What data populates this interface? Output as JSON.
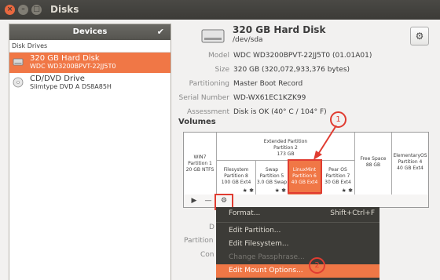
{
  "window": {
    "title": "Disks",
    "close_glyph": "×",
    "min_glyph": "–",
    "max_glyph": "□"
  },
  "sidebar": {
    "header": "Devices",
    "check_glyph": "✔",
    "section": "Disk Drives",
    "items": [
      {
        "line1": "320 GB Hard Disk",
        "line2": "WDC WD3200BPVT-22JJ5T0",
        "icon": "hard-disk-icon",
        "selected": true
      },
      {
        "line1": "CD/DVD Drive",
        "line2": "Slimtype DVD A  DS8A85H",
        "icon": "optical-drive-icon",
        "selected": false
      }
    ]
  },
  "disk": {
    "title": "320 GB Hard Disk",
    "path": "/dev/sda",
    "gear_glyph": "⚙",
    "props": [
      {
        "key": "Model",
        "value": "WDC WD3200BPVT-22JJ5T0 (01.01A01)"
      },
      {
        "key": "Size",
        "value": "320 GB (320,072,933,376 bytes)"
      },
      {
        "key": "Partitioning",
        "value": "Master Boot Record"
      },
      {
        "key": "Serial Number",
        "value": "WD-WX61EC1KZK99"
      },
      {
        "key": "Assessment",
        "value": "Disk is OK (40° C / 104° F)"
      }
    ]
  },
  "volumes": {
    "label": "Volumes",
    "partitions": {
      "win": [
        "WIN7",
        "Partition 1",
        "20 GB NTFS"
      ],
      "extended": [
        "Extended Partition",
        "Partition 2",
        "173 GB"
      ],
      "free": [
        "Free Space",
        "88 GB"
      ],
      "elem": [
        "ElementaryOS",
        "Partition 4",
        "40 GB Ext4"
      ],
      "filesys": [
        "Filesystem",
        "Partition 8",
        "100 GB Ext4"
      ],
      "swap": [
        "Swap",
        "Partition 5",
        "3.0 GB Swap"
      ],
      "mint": [
        "LinuxMint",
        "Partition 6",
        "40 GB Ext4"
      ],
      "peaos": [
        "Pear OS",
        "Partition 7",
        "30 GB Ext4"
      ]
    },
    "star_glyphs": "★ ✱",
    "toolbar": {
      "play_glyph": "▶",
      "minus_glyph": "—",
      "settings_glyph": "⚙"
    }
  },
  "under_labels": [
    "D",
    "Partition",
    "Con"
  ],
  "annotations": {
    "one": "1",
    "two": "2"
  },
  "context_menu": {
    "items": [
      {
        "label": "Format...",
        "shortcut": "Shift+Ctrl+F"
      },
      {
        "label": "Edit Partition..."
      },
      {
        "label": "Edit Filesystem..."
      },
      {
        "label": "Change Passphrase...",
        "disabled": true
      },
      {
        "label": "Edit Mount Options...",
        "highlighted": true
      }
    ]
  },
  "colors": {
    "accent": "#f07746",
    "annotation": "#e03c31",
    "menu_bg": "#3c3b37"
  }
}
